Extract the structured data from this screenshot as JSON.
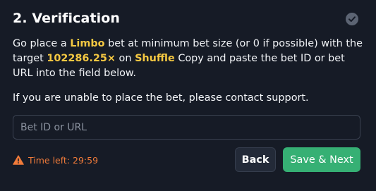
{
  "step": {
    "title": "2. Verification",
    "status_icon": "check-circle-icon"
  },
  "instructions": {
    "part1": "Go place a ",
    "game": "Limbo",
    "part2": " bet at minimum bet size (or 0 if possible) with the target ",
    "target": "102286.25×",
    "part3": " on ",
    "site": "Shuffle",
    "part4": " Copy and paste the bet ID or bet URL into the field below."
  },
  "support_text": "If you are unable to place the bet, please contact support.",
  "bet_input": {
    "placeholder": "Bet ID or URL",
    "value": ""
  },
  "timer": {
    "icon": "warning-icon",
    "text": "Time left: 29:59"
  },
  "buttons": {
    "back_label": "Back",
    "next_label": "Save & Next"
  },
  "colors": {
    "background": "#161b26",
    "highlight": "#f5c842",
    "timer": "#f07b3a",
    "primary_button": "#36b074",
    "secondary_button": "#232a38"
  }
}
